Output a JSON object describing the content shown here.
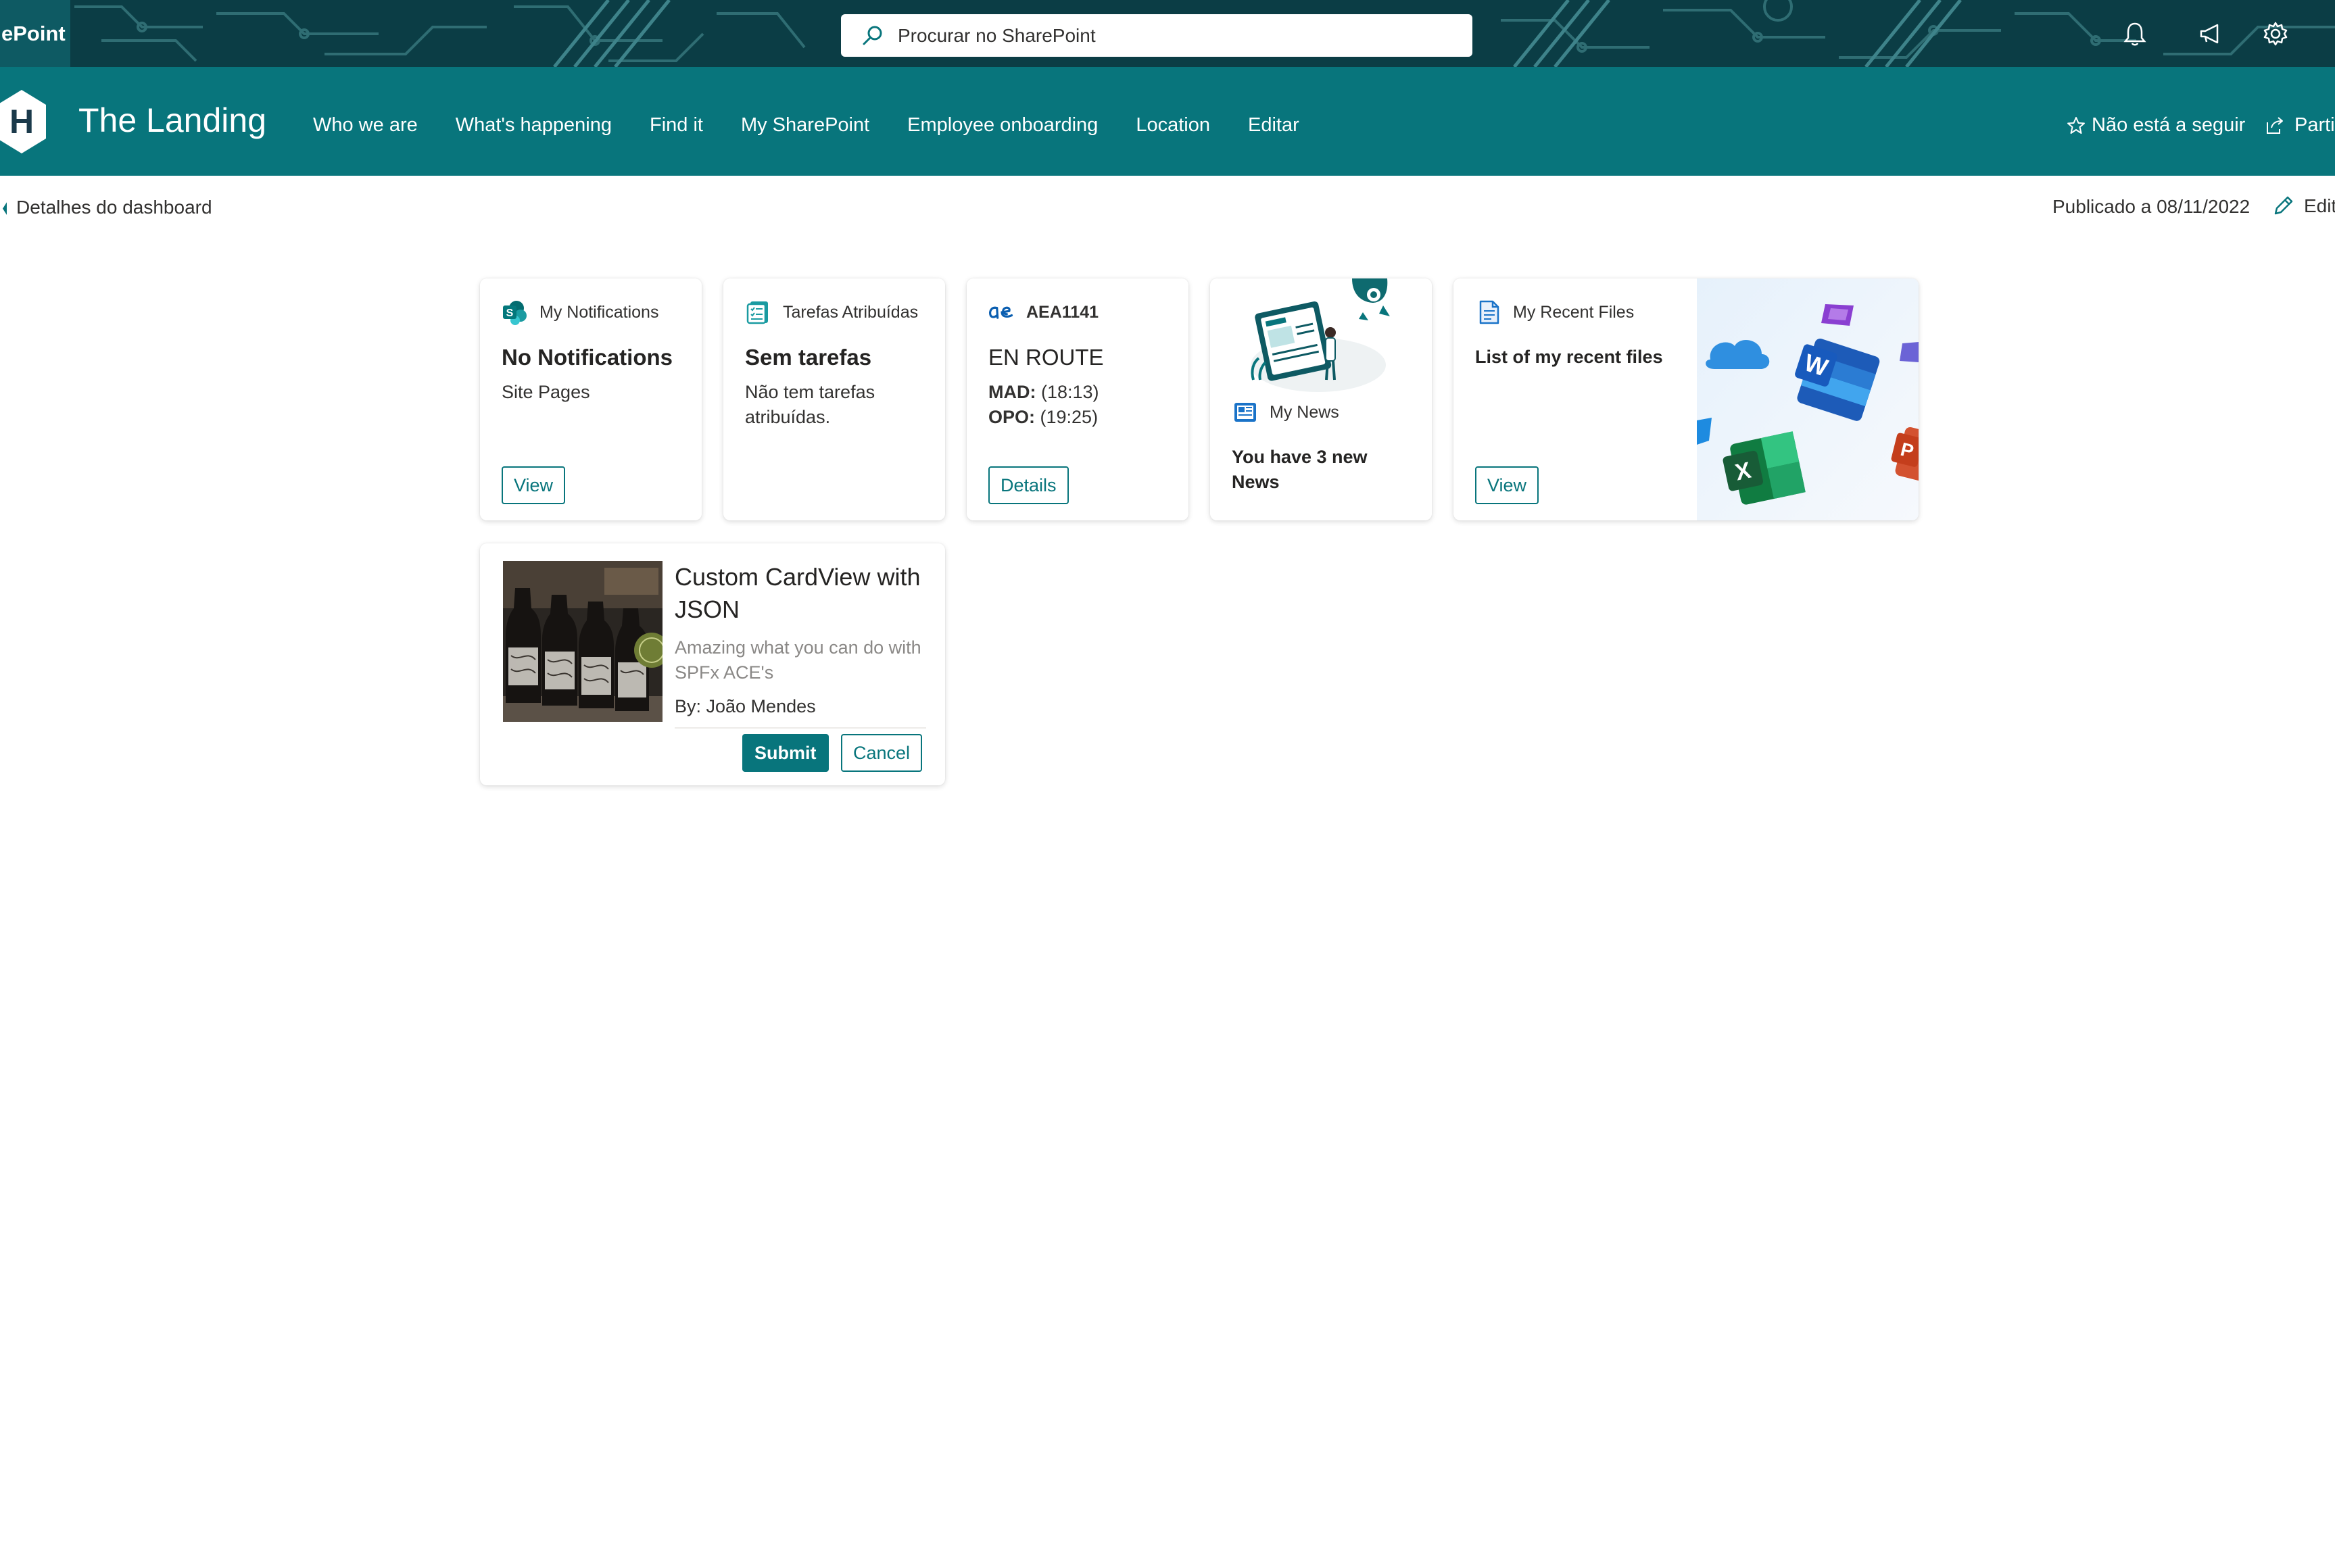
{
  "suite": {
    "app_name": "ePoint",
    "search_placeholder": "Procurar no SharePoint",
    "icons": [
      "bell-icon",
      "megaphone-icon",
      "gear-icon"
    ]
  },
  "site": {
    "logo_letter": "H",
    "title": "The Landing",
    "nav": [
      "Who we are",
      "What's happening",
      "Find it",
      "My SharePoint",
      "Employee onboarding",
      "Location",
      "Editar"
    ],
    "follow_label": "Não está a seguir",
    "share_label": "Parti"
  },
  "command_bar": {
    "details_label": "Detalhes do dashboard",
    "published": "Publicado a 08/11/2022",
    "edit_label": "Edit"
  },
  "cards": {
    "notifications": {
      "header": "My Notifications",
      "title": "No Notifications",
      "subtitle": "Site Pages",
      "button": "View"
    },
    "tasks": {
      "header": "Tarefas Atribuídas",
      "title": "Sem tarefas",
      "subtitle": "Não tem tarefas atribuídas."
    },
    "flight": {
      "header": "AEA1141",
      "title": "EN ROUTE",
      "line1_label": "MAD:",
      "line1_value": " (18:13)",
      "line2_label": "OPO:",
      "line2_value": " (19:25)",
      "button": "Details"
    },
    "news": {
      "header": "My News",
      "subtitle": "You have 3 new News"
    },
    "recent_files": {
      "header": "My Recent Files",
      "subtitle": "List of my recent files",
      "button": "View"
    },
    "custom": {
      "title": "Custom CardView with JSON",
      "description": "Amazing what you can do with SPFx ACE's",
      "author": "By: João Mendes",
      "submit": "Submit",
      "cancel": "Cancel"
    }
  },
  "colors": {
    "theme": "#08757c",
    "suitebar": "#0b3d45",
    "text": "#323130"
  }
}
